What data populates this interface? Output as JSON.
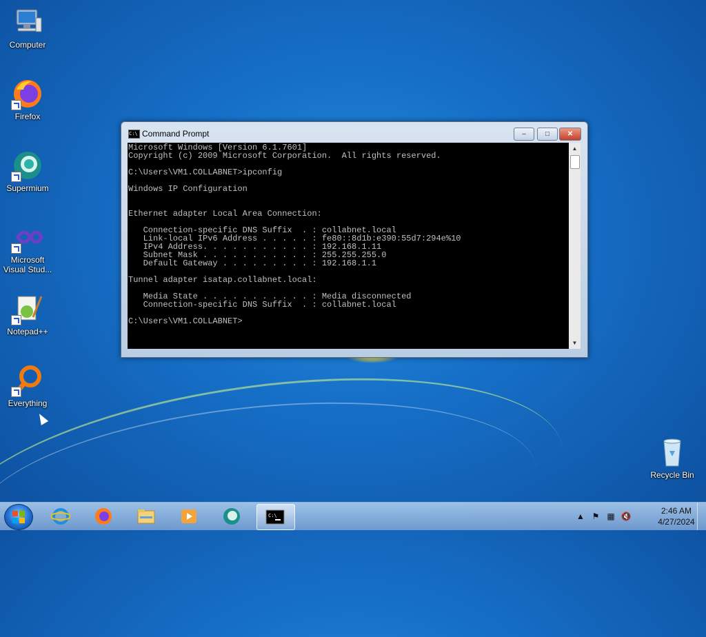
{
  "desktop": {
    "icons": [
      {
        "label": "Computer"
      },
      {
        "label": "Firefox"
      },
      {
        "label": "Supermium"
      },
      {
        "label": "Microsoft Visual Stud..."
      },
      {
        "label": "Notepad++"
      },
      {
        "label": "Everything"
      },
      {
        "label": "Recycle Bin"
      }
    ]
  },
  "window": {
    "title": "Command Prompt",
    "title_icon": "C:\\",
    "minimize_label": "–",
    "maximize_label": "□",
    "close_label": "✕",
    "console_text": "Microsoft Windows [Version 6.1.7601]\nCopyright (c) 2009 Microsoft Corporation.  All rights reserved.\n\nC:\\Users\\VM1.COLLABNET>ipconfig\n\nWindows IP Configuration\n\n\nEthernet adapter Local Area Connection:\n\n   Connection-specific DNS Suffix  . : collabnet.local\n   Link-local IPv6 Address . . . . . : fe80::8d1b:e390:55d7:294e%10\n   IPv4 Address. . . . . . . . . . . : 192.168.1.11\n   Subnet Mask . . . . . . . . . . . : 255.255.255.0\n   Default Gateway . . . . . . . . . : 192.168.1.1\n\nTunnel adapter isatap.collabnet.local:\n\n   Media State . . . . . . . . . . . : Media disconnected\n   Connection-specific DNS Suffix  . : collabnet.local\n\nC:\\Users\\VM1.COLLABNET>"
  },
  "taskbar": {
    "pinned": [
      "internet-explorer-icon",
      "firefox-icon",
      "windows-explorer-icon",
      "media-player-icon",
      "supermium-icon",
      "command-prompt-icon"
    ],
    "clock_time": "2:46 AM",
    "clock_date": "4/27/2024"
  }
}
